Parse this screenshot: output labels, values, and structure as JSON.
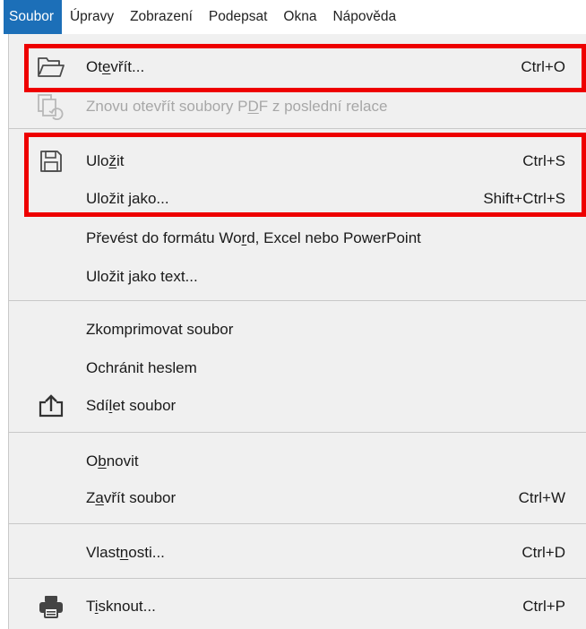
{
  "menubar": {
    "items": [
      {
        "label": "Soubor",
        "active": true
      },
      {
        "label": "Úpravy"
      },
      {
        "label": "Zobrazení"
      },
      {
        "label": "Podepsat"
      },
      {
        "label": "Okna"
      },
      {
        "label": "Nápověda"
      }
    ]
  },
  "menu": {
    "items": [
      {
        "pre": "Ot",
        "ul": "e",
        "post": "vřít...",
        "shortcut": "Ctrl+O",
        "icon": "open-folder-icon",
        "enabled": true
      },
      {
        "pre": "Znovu otevřít soubory P",
        "ul": "D",
        "post": "F z poslední relace",
        "shortcut": "",
        "icon": "reopen-files-icon",
        "enabled": false
      },
      {
        "pre": "Ulo",
        "ul": "ž",
        "post": "it",
        "shortcut": "Ctrl+S",
        "icon": "save-disk-icon",
        "enabled": true
      },
      {
        "pre": "Uložit jako...",
        "ul": "",
        "post": "",
        "shortcut": "Shift+Ctrl+S",
        "icon": "",
        "enabled": true
      },
      {
        "pre": "Převést do formátu Wo",
        "ul": "r",
        "post": "d, Excel nebo PowerPoint",
        "shortcut": "",
        "icon": "",
        "enabled": true
      },
      {
        "pre": "Uložit ",
        "ul": "j",
        "post": "ako text...",
        "shortcut": "",
        "icon": "",
        "enabled": true
      },
      {
        "pre": "Zkomprimovat soubor",
        "ul": "",
        "post": "",
        "shortcut": "",
        "icon": "",
        "enabled": true
      },
      {
        "pre": "Ochránit heslem",
        "ul": "",
        "post": "",
        "shortcut": "",
        "icon": "",
        "enabled": true
      },
      {
        "pre": "Sdí",
        "ul": "l",
        "post": "et soubor",
        "shortcut": "",
        "icon": "share-icon",
        "enabled": true
      },
      {
        "pre": "O",
        "ul": "b",
        "post": "novit",
        "shortcut": "",
        "icon": "",
        "enabled": true
      },
      {
        "pre": "Z",
        "ul": "a",
        "post": "vřít soubor",
        "shortcut": "Ctrl+W",
        "icon": "",
        "enabled": true
      },
      {
        "pre": "Vlast",
        "ul": "n",
        "post": "osti...",
        "shortcut": "Ctrl+D",
        "icon": "",
        "enabled": true
      },
      {
        "pre": "T",
        "ul": "i",
        "post": "sknout...",
        "shortcut": "Ctrl+P",
        "icon": "printer-icon",
        "enabled": true
      }
    ]
  },
  "colors": {
    "active_menu_bg": "#1c6fb8",
    "menu_bg": "#f0f0f0",
    "highlight": "#ee0000",
    "disabled_text": "#a7a7a7"
  }
}
